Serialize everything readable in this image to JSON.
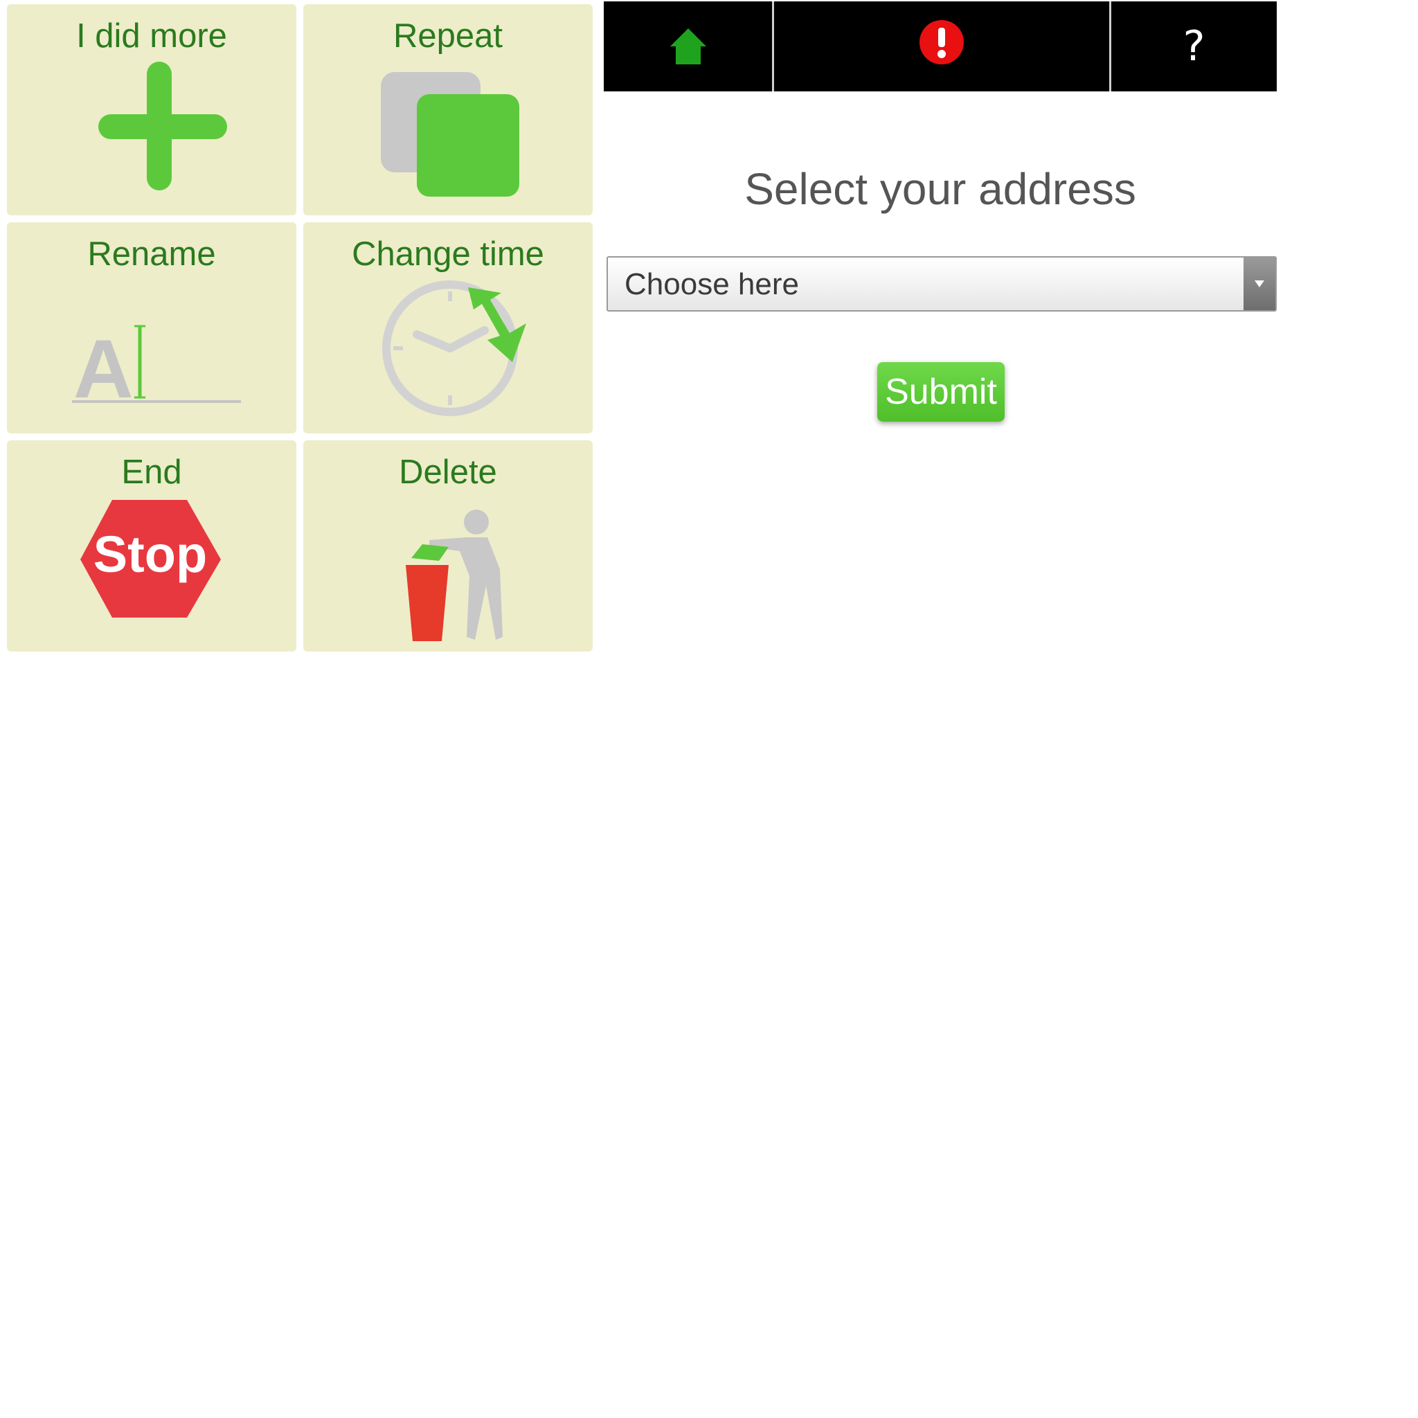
{
  "tiles": [
    {
      "label": "I did more",
      "icon": "plus-icon"
    },
    {
      "label": "Repeat",
      "icon": "repeat-icon"
    },
    {
      "label": "Rename",
      "icon": "rename-icon"
    },
    {
      "label": "Change time",
      "icon": "clock-icon"
    },
    {
      "label": "End",
      "icon": "stop-sign-icon",
      "icon_text": "Stop"
    },
    {
      "label": "Delete",
      "icon": "trash-icon"
    }
  ],
  "topbar": {
    "home_icon": "home-icon",
    "alert_icon": "alert-icon",
    "help_icon": "help-icon",
    "help_glyph": "?"
  },
  "form": {
    "title": "Select your address",
    "select_value": "Choose here",
    "submit_label": "Submit"
  },
  "colors": {
    "tile_bg": "#ededca",
    "label_green": "#2b7a1e",
    "icon_green": "#5cc93c",
    "stop_red": "#e8383f",
    "alert_red": "#e81010",
    "topbar_bg": "#000000"
  }
}
